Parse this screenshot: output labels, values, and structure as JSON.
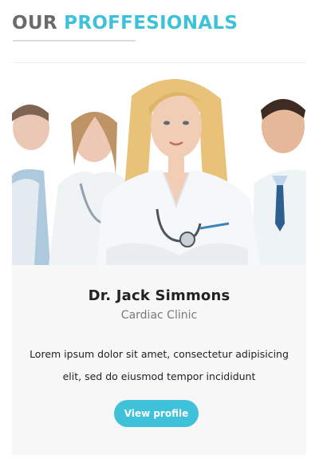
{
  "section": {
    "title_part_1": "OUR",
    "title_part_2": "PROFFESIONALS"
  },
  "profile": {
    "name": "Dr. Jack Simmons",
    "clinic": "Cardiac Clinic",
    "bio": "Lorem ipsum dolor sit amet, consectetur adipisicing elit, sed do eiusmod tempor incididunt",
    "button_label": "View profile"
  },
  "colors": {
    "accent": "#3ec1d9",
    "title_gray": "#6b6b6b",
    "card_background": "#f7f7f7"
  }
}
